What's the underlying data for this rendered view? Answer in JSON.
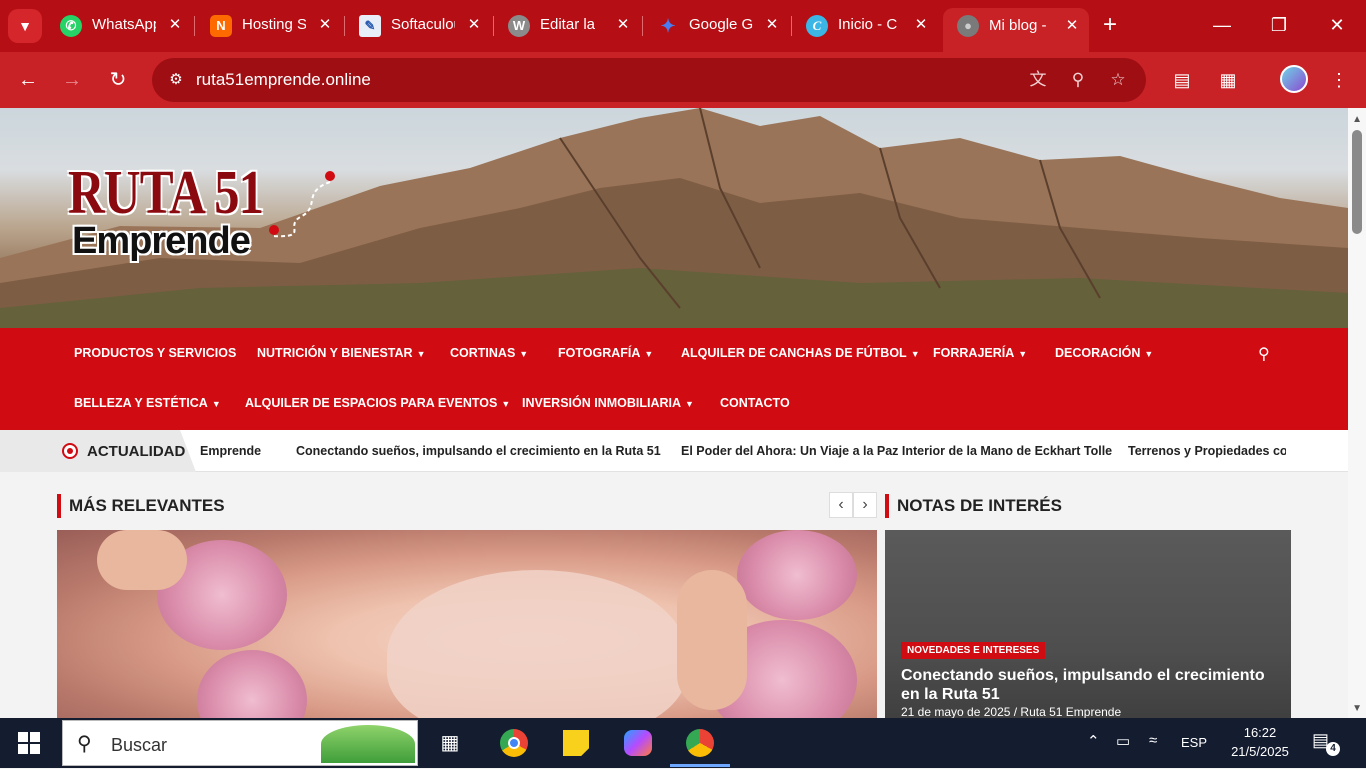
{
  "browser": {
    "tabs": [
      {
        "title": "WhatsApp",
        "favicon": "whatsapp-icon",
        "color": "#25d366"
      },
      {
        "title": "Hosting S",
        "favicon": "hosting-icon",
        "color": "#ff6a00"
      },
      {
        "title": "Softaculous",
        "favicon": "softaculous-icon",
        "color": "#e8eef7"
      },
      {
        "title": "Editar la",
        "favicon": "wordpress-icon",
        "color": "#8b8b8b"
      },
      {
        "title": "Google G",
        "favicon": "gemini-icon",
        "color": "#4a7cf0"
      },
      {
        "title": "Inicio - C",
        "favicon": "canva-icon",
        "color": "#3cb7e5"
      },
      {
        "title": "Mi blog -",
        "favicon": "globe-icon",
        "color": "#7a7a7a"
      }
    ],
    "url": "ruta51emprende.online"
  },
  "site": {
    "logo_line1": "RUTA 51",
    "logo_line2": "Emprende",
    "nav": [
      {
        "label": "PRODUCTOS Y SERVICIOS",
        "dropdown": false
      },
      {
        "label": "NUTRICIÓN Y BIENESTAR",
        "dropdown": true
      },
      {
        "label": "CORTINAS",
        "dropdown": true
      },
      {
        "label": "FOTOGRAFÍA",
        "dropdown": true
      },
      {
        "label": "ALQUILER DE CANCHAS DE FÚTBOL",
        "dropdown": true
      },
      {
        "label": "FORRAJERÍA",
        "dropdown": true
      },
      {
        "label": "DECORACIÓN",
        "dropdown": true
      },
      {
        "label": "BELLEZA Y ESTÉTICA",
        "dropdown": true
      },
      {
        "label": "ALQUILER DE ESPACIOS PARA EVENTOS",
        "dropdown": true
      },
      {
        "label": "INVERSIÓN INMOBILIARIA",
        "dropdown": true
      },
      {
        "label": "CONTACTO",
        "dropdown": false
      }
    ],
    "ticker": {
      "label": "ACTUALIDAD",
      "items": [
        "Emprende",
        "Conectando sueños, impulsando el crecimiento en la Ruta 51",
        "El Poder del Ahora: Un Viaje a la Paz Interior de la Mano de Eckhart Tolle",
        "Terrenos y Propiedades con"
      ]
    },
    "relevant_title": "MÁS RELEVANTES",
    "notes_title": "NOTAS DE INTERÉS",
    "notes_card": {
      "badge": "NOVEDADES E INTERESES",
      "title": "Conectando sueños, impulsando el crecimiento en la Ruta 51",
      "meta": "21 de mayo de 2025 / Ruta 51 Emprende"
    },
    "accent": "#d10b12"
  },
  "taskbar": {
    "search_placeholder": "Buscar",
    "language": "ESP",
    "time": "16:22",
    "date": "21/5/2025",
    "notifications": "4"
  }
}
